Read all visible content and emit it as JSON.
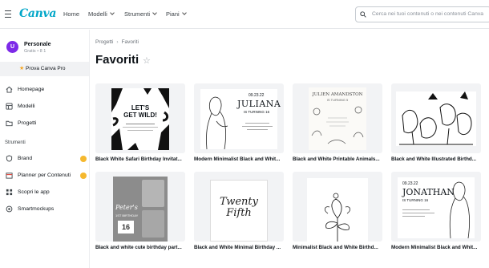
{
  "app": {
    "logo": "Canva"
  },
  "topnav": {
    "home": "Home",
    "models": "Modelli",
    "tools": "Strumenti",
    "plans": "Piani"
  },
  "search": {
    "placeholder": "Cerca nei tuoi contenuti o nei contenuti Canva"
  },
  "account": {
    "initial": "U",
    "name": "Personale",
    "sub": "Gratis • 8 1"
  },
  "sidebar": {
    "pro_label": "Prova Canva Pro",
    "items": [
      {
        "label": "Homepage",
        "icon": "home-icon"
      },
      {
        "label": "Modelli",
        "icon": "templates-icon"
      },
      {
        "label": "Progetti",
        "icon": "folder-icon"
      }
    ],
    "tools_heading": "Strumenti",
    "tools": [
      {
        "label": "Brand",
        "icon": "brand-icon",
        "crown": true
      },
      {
        "label": "Planner per Contenuti",
        "icon": "calendar-icon",
        "crown": true
      },
      {
        "label": "Scopri le app",
        "icon": "apps-icon",
        "crown": false
      },
      {
        "label": "Smartmockups",
        "icon": "mockups-icon",
        "crown": false
      }
    ]
  },
  "main": {
    "breadcrumb": [
      "Progetti",
      "Favoriti"
    ],
    "title": "Favoriti",
    "cards": [
      {
        "caption": "Black White Safari Birthday Invitat...",
        "thumb_text": [
          "LET'S",
          "GET WILD!"
        ]
      },
      {
        "caption": "Modern Minimalist Black and Whit...",
        "thumb_text": [
          "09.23.22",
          "JULIANA",
          "IS TURNING 16"
        ]
      },
      {
        "caption": "Black and White Printable Animals...",
        "thumb_text": [
          "JULIEN AMANDSTON",
          "IS TURNING 5"
        ]
      },
      {
        "caption": "Black and White Illustrated Birthd...",
        "thumb_text": []
      },
      {
        "caption": "Black and white cute birthday part...",
        "thumb_text": [
          "Peter's",
          "1ST BIRTHDAY",
          "16"
        ]
      },
      {
        "caption": "Black and White Minimal Birthday ...",
        "thumb_text": [
          "Twenty",
          "Fifth"
        ]
      },
      {
        "caption": "Minimalist Black and White Birthd...",
        "thumb_text": []
      },
      {
        "caption": "Modern Minimalist Black and Whit...",
        "thumb_text": [
          "09.23.22",
          "JONATHAN",
          "IS TURNING 16"
        ]
      }
    ]
  },
  "colors": {
    "brand": "#00a6c8",
    "avatar": "#7d2ae8",
    "crown": "#f5b82e"
  }
}
